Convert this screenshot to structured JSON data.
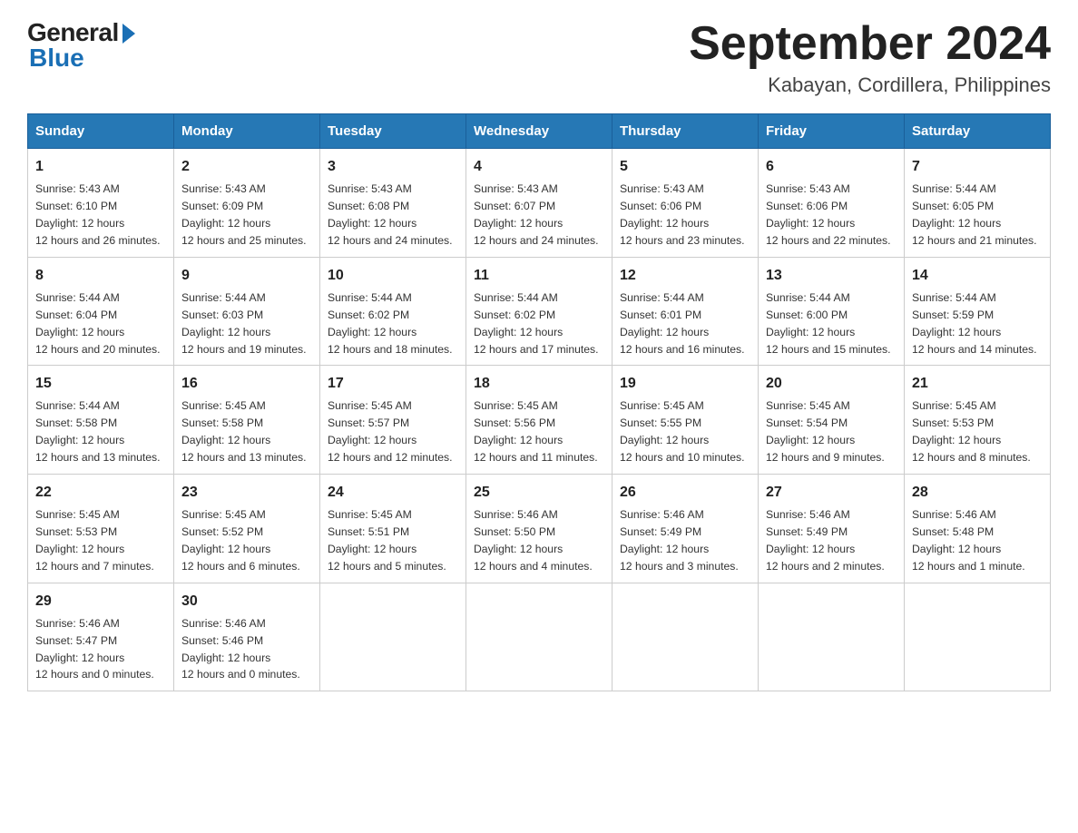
{
  "logo": {
    "general": "General",
    "blue": "Blue"
  },
  "header": {
    "month": "September 2024",
    "location": "Kabayan, Cordillera, Philippines"
  },
  "weekdays": [
    "Sunday",
    "Monday",
    "Tuesday",
    "Wednesday",
    "Thursday",
    "Friday",
    "Saturday"
  ],
  "weeks": [
    [
      {
        "day": "1",
        "sunrise": "5:43 AM",
        "sunset": "6:10 PM",
        "daylight": "12 hours and 26 minutes."
      },
      {
        "day": "2",
        "sunrise": "5:43 AM",
        "sunset": "6:09 PM",
        "daylight": "12 hours and 25 minutes."
      },
      {
        "day": "3",
        "sunrise": "5:43 AM",
        "sunset": "6:08 PM",
        "daylight": "12 hours and 24 minutes."
      },
      {
        "day": "4",
        "sunrise": "5:43 AM",
        "sunset": "6:07 PM",
        "daylight": "12 hours and 24 minutes."
      },
      {
        "day": "5",
        "sunrise": "5:43 AM",
        "sunset": "6:06 PM",
        "daylight": "12 hours and 23 minutes."
      },
      {
        "day": "6",
        "sunrise": "5:43 AM",
        "sunset": "6:06 PM",
        "daylight": "12 hours and 22 minutes."
      },
      {
        "day": "7",
        "sunrise": "5:44 AM",
        "sunset": "6:05 PM",
        "daylight": "12 hours and 21 minutes."
      }
    ],
    [
      {
        "day": "8",
        "sunrise": "5:44 AM",
        "sunset": "6:04 PM",
        "daylight": "12 hours and 20 minutes."
      },
      {
        "day": "9",
        "sunrise": "5:44 AM",
        "sunset": "6:03 PM",
        "daylight": "12 hours and 19 minutes."
      },
      {
        "day": "10",
        "sunrise": "5:44 AM",
        "sunset": "6:02 PM",
        "daylight": "12 hours and 18 minutes."
      },
      {
        "day": "11",
        "sunrise": "5:44 AM",
        "sunset": "6:02 PM",
        "daylight": "12 hours and 17 minutes."
      },
      {
        "day": "12",
        "sunrise": "5:44 AM",
        "sunset": "6:01 PM",
        "daylight": "12 hours and 16 minutes."
      },
      {
        "day": "13",
        "sunrise": "5:44 AM",
        "sunset": "6:00 PM",
        "daylight": "12 hours and 15 minutes."
      },
      {
        "day": "14",
        "sunrise": "5:44 AM",
        "sunset": "5:59 PM",
        "daylight": "12 hours and 14 minutes."
      }
    ],
    [
      {
        "day": "15",
        "sunrise": "5:44 AM",
        "sunset": "5:58 PM",
        "daylight": "12 hours and 13 minutes."
      },
      {
        "day": "16",
        "sunrise": "5:45 AM",
        "sunset": "5:58 PM",
        "daylight": "12 hours and 13 minutes."
      },
      {
        "day": "17",
        "sunrise": "5:45 AM",
        "sunset": "5:57 PM",
        "daylight": "12 hours and 12 minutes."
      },
      {
        "day": "18",
        "sunrise": "5:45 AM",
        "sunset": "5:56 PM",
        "daylight": "12 hours and 11 minutes."
      },
      {
        "day": "19",
        "sunrise": "5:45 AM",
        "sunset": "5:55 PM",
        "daylight": "12 hours and 10 minutes."
      },
      {
        "day": "20",
        "sunrise": "5:45 AM",
        "sunset": "5:54 PM",
        "daylight": "12 hours and 9 minutes."
      },
      {
        "day": "21",
        "sunrise": "5:45 AM",
        "sunset": "5:53 PM",
        "daylight": "12 hours and 8 minutes."
      }
    ],
    [
      {
        "day": "22",
        "sunrise": "5:45 AM",
        "sunset": "5:53 PM",
        "daylight": "12 hours and 7 minutes."
      },
      {
        "day": "23",
        "sunrise": "5:45 AM",
        "sunset": "5:52 PM",
        "daylight": "12 hours and 6 minutes."
      },
      {
        "day": "24",
        "sunrise": "5:45 AM",
        "sunset": "5:51 PM",
        "daylight": "12 hours and 5 minutes."
      },
      {
        "day": "25",
        "sunrise": "5:46 AM",
        "sunset": "5:50 PM",
        "daylight": "12 hours and 4 minutes."
      },
      {
        "day": "26",
        "sunrise": "5:46 AM",
        "sunset": "5:49 PM",
        "daylight": "12 hours and 3 minutes."
      },
      {
        "day": "27",
        "sunrise": "5:46 AM",
        "sunset": "5:49 PM",
        "daylight": "12 hours and 2 minutes."
      },
      {
        "day": "28",
        "sunrise": "5:46 AM",
        "sunset": "5:48 PM",
        "daylight": "12 hours and 1 minute."
      }
    ],
    [
      {
        "day": "29",
        "sunrise": "5:46 AM",
        "sunset": "5:47 PM",
        "daylight": "12 hours and 0 minutes."
      },
      {
        "day": "30",
        "sunrise": "5:46 AM",
        "sunset": "5:46 PM",
        "daylight": "12 hours and 0 minutes."
      },
      null,
      null,
      null,
      null,
      null
    ]
  ],
  "labels": {
    "sunrise": "Sunrise:",
    "sunset": "Sunset:",
    "daylight": "Daylight:"
  }
}
